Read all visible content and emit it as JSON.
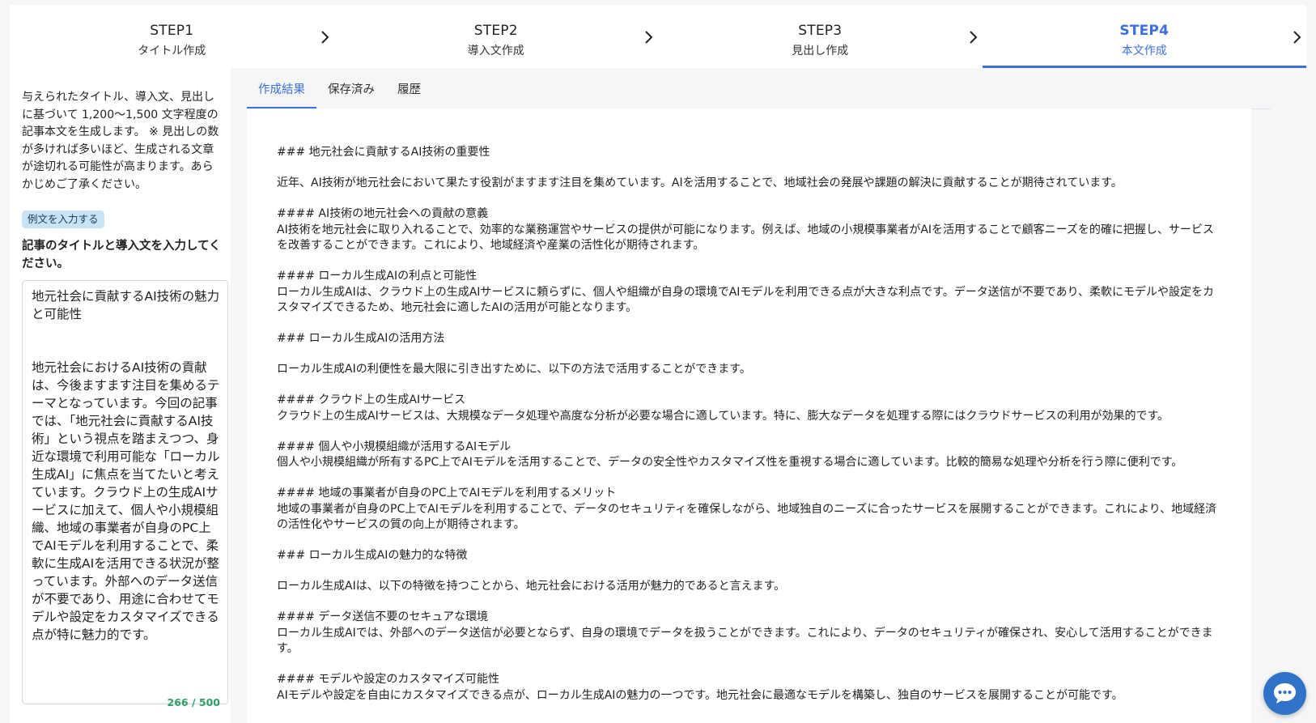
{
  "stepper": {
    "steps": [
      {
        "num": "STEP1",
        "label": "タイトル作成"
      },
      {
        "num": "STEP2",
        "label": "導入文作成"
      },
      {
        "num": "STEP3",
        "label": "見出し作成"
      },
      {
        "num": "STEP4",
        "label": "本文作成"
      }
    ],
    "active_step": 4
  },
  "sidebar": {
    "description": "与えられたタイトル、導入文、見出しに基づいて 1,200〜1,500 文字程度の記事本文を生成します。 ※ 見出しの数が多ければ多いほど、生成される文章が途切れる可能性が高まります。あらかじめご了承ください。",
    "example_button": "例文を入力する",
    "input_label": "記事のタイトルと導入文を入力してください。",
    "input_value": "地元社会に貢献するAI技術の魅力と可能性\n\n\n地元社会におけるAI技術の貢献は、今後ますます注目を集めるテーマとなっています。今回の記事では、「地元社会に貢献するAI技術」という視点を踏まえつつ、身近な環境で利用可能な「ローカル生成AI」に焦点を当てたいと考えています。クラウド上の生成AIサービスに加えて、個人や小規模組織、地域の事業者が自身のPC上でAIモデルを利用することで、柔軟に生成AIを活用できる状況が整っています。外部へのデータ送信が不要であり、用途に合わせてモデルや設定をカスタマイズできる点が特に魅力的です。",
    "char_count": "266 / 500"
  },
  "tabs": [
    {
      "label": "作成結果"
    },
    {
      "label": "保存済み"
    },
    {
      "label": "履歴"
    }
  ],
  "result": {
    "paragraphs": [
      "### 地元社会に貢献するAI技術の重要性",
      "近年、AI技術が地元社会において果たす役割がますます注目を集めています。AIを活用することで、地域社会の発展や課題の解決に貢献することが期待されています。",
      "#### AI技術の地元社会への貢献の意義\nAI技術を地元社会に取り入れることで、効率的な業務運営やサービスの提供が可能になります。例えば、地域の小規模事業者がAIを活用することで顧客ニーズを的確に把握し、サービスを改善することができます。これにより、地域経済や産業の活性化が期待されます。",
      "#### ローカル生成AIの利点と可能性\nローカル生成AIは、クラウド上の生成AIサービスに頼らずに、個人や組織が自身の環境でAIモデルを利用できる点が大きな利点です。データ送信が不要であり、柔軟にモデルや設定をカスタマイズできるため、地元社会に適したAIの活用が可能となります。",
      "### ローカル生成AIの活用方法",
      "ローカル生成AIの利便性を最大限に引き出すために、以下の方法で活用することができます。",
      "#### クラウド上の生成AIサービス\nクラウド上の生成AIサービスは、大規模なデータ処理や高度な分析が必要な場合に適しています。特に、膨大なデータを処理する際にはクラウドサービスの利用が効果的です。",
      "#### 個人や小規模組織が活用するAIモデル\n個人や小規模組織が所有するPC上でAIモデルを活用することで、データの安全性やカスタマイズ性を重視する場合に適しています。比較的簡易な処理や分析を行う際に便利です。",
      "#### 地域の事業者が自身のPC上でAIモデルを利用するメリット\n地域の事業者が自身のPC上でAIモデルを利用することで、データのセキュリティを確保しながら、地域独自のニーズに合ったサービスを展開することができます。これにより、地域経済の活性化やサービスの質の向上が期待されます。",
      "### ローカル生成AIの魅力的な特徴",
      "ローカル生成AIは、以下の特徴を持つことから、地元社会における活用が魅力的であると言えます。",
      "#### データ送信不要のセキュアな環境\nローカル生成AIでは、外部へのデータ送信が必要とならず、自身の環境でデータを扱うことができます。これにより、データのセキュリティが確保され、安心して活用することができます。",
      "#### モデルや設定のカスタマイズ可能性\nAIモデルや設定を自由にカスタマイズできる点が、ローカル生成AIの魅力の一つです。地元社会に最適なモデルを構築し、独自のサービスを展開することが可能です。"
    ]
  },
  "colors": {
    "accent": "#3a6fe0",
    "chat_button": "#2f73c8",
    "count_ok": "#2e9e63",
    "example_button_bg": "#c8e2f6"
  }
}
